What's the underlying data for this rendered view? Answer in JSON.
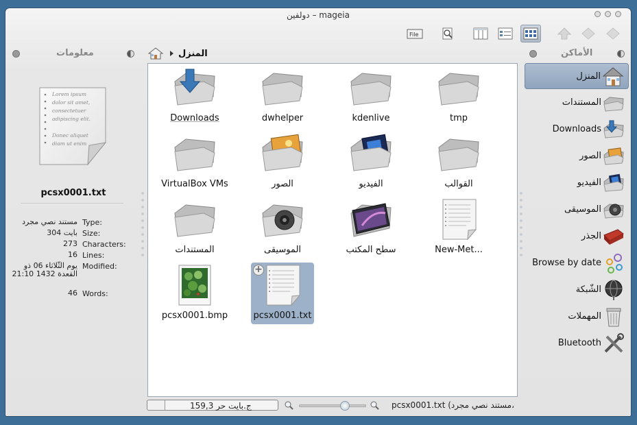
{
  "window": {
    "title": "دولفين – mageia"
  },
  "toolbar": {
    "file_button": "File",
    "buttons": [
      "split-view",
      "preview",
      "columns-view",
      "details-view",
      "icons-view",
      "up",
      "forward",
      "back"
    ]
  },
  "info_panel": {
    "title": "معلومات",
    "preview_text": [
      "Lorem ipsum",
      "dolor sit amet,",
      "consectetuer",
      "adipiscing elit.",
      "",
      "Donec aliquet",
      "diam ut enim"
    ],
    "filename": "pcsx0001.txt",
    "rows": [
      {
        "label": "Type:",
        "value": "مستند نصي مجرد"
      },
      {
        "label": "Size:",
        "value": "304 بايت"
      },
      {
        "label": "Characters:",
        "value": "273"
      },
      {
        "label": "Lines:",
        "value": "16"
      },
      {
        "label": "Modified:",
        "value": "يوم الثّلاثاء 06 ذو القعدة 1432 21:10"
      },
      {
        "label": "Words:",
        "value": "46"
      }
    ]
  },
  "breadcrumb": {
    "label": "المنزل"
  },
  "files": [
    {
      "name": "Downloads",
      "icon": "downloads-folder-icon"
    },
    {
      "name": "dwhelper",
      "icon": "folder-icon"
    },
    {
      "name": "kdenlive",
      "icon": "folder-icon"
    },
    {
      "name": "tmp",
      "icon": "folder-icon"
    },
    {
      "name": "VirtualBox VMs",
      "icon": "folder-icon"
    },
    {
      "name": "الصور",
      "icon": "pictures-folder-icon"
    },
    {
      "name": "الفيديو",
      "icon": "videos-folder-icon"
    },
    {
      "name": "القوالب",
      "icon": "folder-icon"
    },
    {
      "name": "المستندات",
      "icon": "folder-icon"
    },
    {
      "name": "الموسيقى",
      "icon": "music-folder-icon"
    },
    {
      "name": "سطح المكتب",
      "icon": "desktop-folder-icon"
    },
    {
      "name": "New-Met...",
      "icon": "text-file-icon"
    },
    {
      "name": "pcsx0001.bmp",
      "icon": "image-file-icon"
    },
    {
      "name": "pcsx0001.txt",
      "icon": "text-file-icon"
    }
  ],
  "places_panel": {
    "title": "الأماكن",
    "items": [
      {
        "label": "المنزل",
        "icon": "home-icon"
      },
      {
        "label": "المستندات",
        "icon": "documents-icon"
      },
      {
        "label": "Downloads",
        "icon": "downloads-icon"
      },
      {
        "label": "الصور",
        "icon": "pictures-icon"
      },
      {
        "label": "الفيديو",
        "icon": "videos-icon"
      },
      {
        "label": "الموسيقى",
        "icon": "music-icon"
      },
      {
        "label": "الجذر",
        "icon": "root-icon"
      },
      {
        "label": "Browse by date",
        "icon": "calendar-browse-icon"
      },
      {
        "label": "الشّبكة",
        "icon": "network-icon"
      },
      {
        "label": "المهملات",
        "icon": "trash-icon"
      },
      {
        "label": "Bluetooth",
        "icon": "bluetooth-icon"
      }
    ]
  },
  "status": {
    "free_space": "159,3 ج.بايت حر",
    "selection_text": "pcsx0001.txt (مستند نصي مجرد،",
    "zoom_level": 0.72
  }
}
